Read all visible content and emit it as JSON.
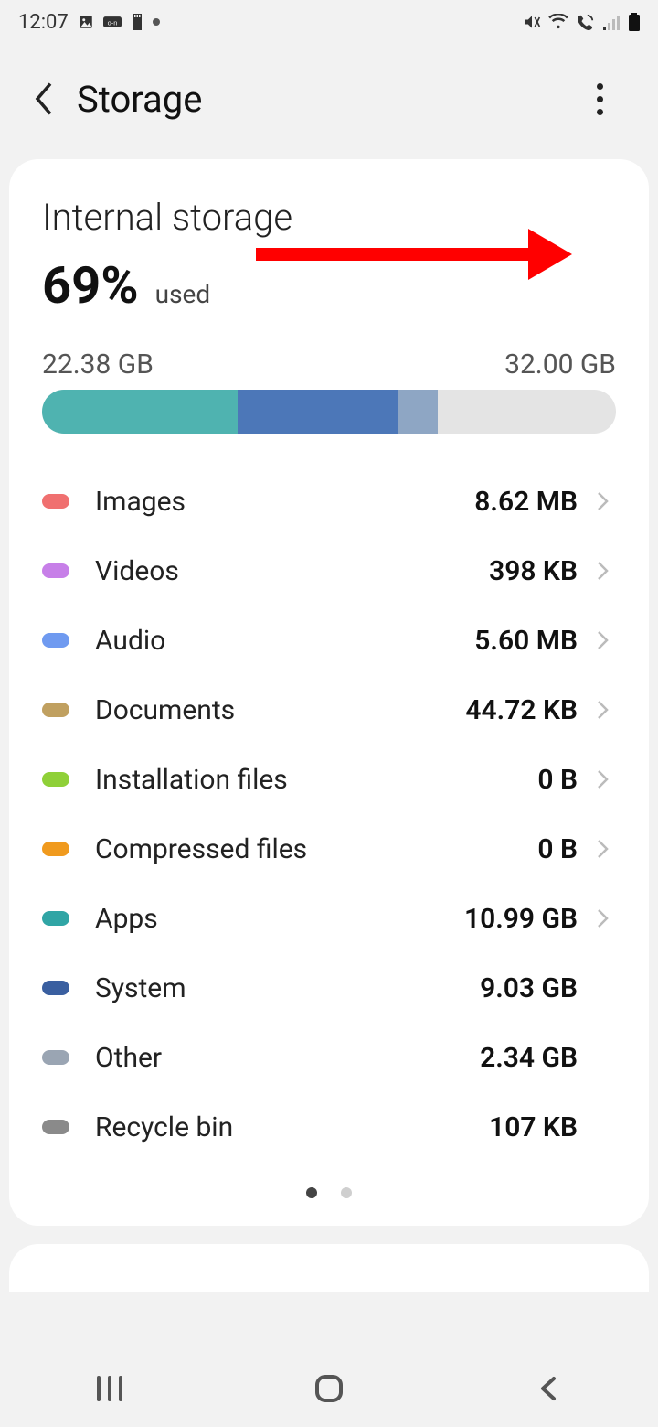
{
  "status": {
    "time": "12:07"
  },
  "header": {
    "title": "Storage"
  },
  "summary": {
    "title": "Internal storage",
    "percent": "69%",
    "used_label": "used",
    "used_size": "22.38 GB",
    "total_size": "32.00 GB"
  },
  "segments": [
    {
      "width": "34%",
      "cls": "seg1"
    },
    {
      "width": "28%",
      "cls": "seg2"
    },
    {
      "width": "7%",
      "cls": "seg3"
    }
  ],
  "categories": [
    {
      "label": "Images",
      "value": "8.62 MB",
      "color": "#f07070",
      "nav": true
    },
    {
      "label": "Videos",
      "value": "398 KB",
      "color": "#c77fe8",
      "nav": true
    },
    {
      "label": "Audio",
      "value": "5.60 MB",
      "color": "#6f9af0",
      "nav": true
    },
    {
      "label": "Documents",
      "value": "44.72 KB",
      "color": "#c0a060",
      "nav": true
    },
    {
      "label": "Installation files",
      "value": "0 B",
      "color": "#8fd038",
      "nav": true
    },
    {
      "label": "Compressed files",
      "value": "0 B",
      "color": "#f09a1e",
      "nav": true
    },
    {
      "label": "Apps",
      "value": "10.99 GB",
      "color": "#30a5a5",
      "nav": true
    },
    {
      "label": "System",
      "value": "9.03 GB",
      "color": "#3a5fa0",
      "nav": false
    },
    {
      "label": "Other",
      "value": "2.34 GB",
      "color": "#9aa5b3",
      "nav": false
    },
    {
      "label": "Recycle bin",
      "value": "107 KB",
      "color": "#8a8a8a",
      "nav": false
    }
  ]
}
